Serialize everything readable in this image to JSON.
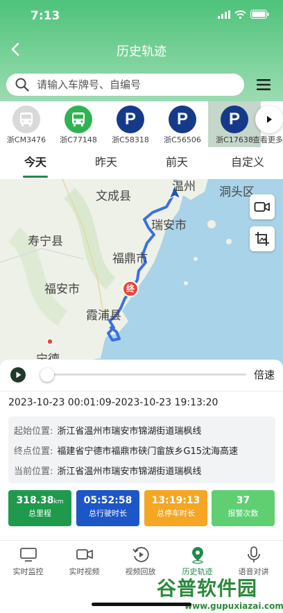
{
  "status_bar": {
    "time": "7:13"
  },
  "nav": {
    "title": "历史轨迹"
  },
  "search": {
    "placeholder": "请输入车牌号、自编号"
  },
  "vehicles": [
    {
      "plate": "浙CM3476",
      "icon": "bus-icon",
      "color": "#d9d9d9"
    },
    {
      "plate": "浙C77148",
      "icon": "bus-icon",
      "color": "#2fb352"
    },
    {
      "plate": "浙C58318",
      "icon": "parking-icon",
      "color": "#163a8a"
    },
    {
      "plate": "浙C56506",
      "icon": "parking-icon",
      "color": "#163a8a"
    },
    {
      "plate": "浙C17638",
      "icon": "parking-icon",
      "color": "#163a8a",
      "selected": true
    }
  ],
  "more_label": "查看更多",
  "tabs": [
    {
      "label": "今天",
      "active": true
    },
    {
      "label": "昨天"
    },
    {
      "label": "前天"
    },
    {
      "label": "自定义"
    }
  ],
  "map": {
    "labels": [
      "文成县",
      "温州",
      "洞头区",
      "瑞安市",
      "寿宁县",
      "福鼎市",
      "福安市",
      "霞浦县",
      "宁德"
    ],
    "end_marker": "终"
  },
  "playback": {
    "speed_label": "倍速",
    "progress": 0
  },
  "time_range": "2023-10-23 00:01:09-2023-10-23 19:13:20",
  "info": {
    "start_label": "起始位置:",
    "start_value": "浙江省温州市瑞安市锦湖街道瑞枫线",
    "end_label": "终点位置:",
    "end_value": "福建省宁德市福鼎市硖门畲族乡G15沈海高速",
    "current_label": "当前位置:",
    "current_value": "浙江省温州市瑞安市锦湖街道瑞枫线"
  },
  "stats": [
    {
      "value": "318.38",
      "unit": "km",
      "caption": "总里程",
      "color": "#1f9a4c"
    },
    {
      "value": "05:52:58",
      "unit": "",
      "caption": "总行驶时长",
      "color": "#1d56c7"
    },
    {
      "value": "13:19:13",
      "unit": "",
      "caption": "总停车时长",
      "color": "#f5a623"
    },
    {
      "value": "37",
      "unit": "",
      "caption": "报警次数",
      "color": "#5fcf71"
    }
  ],
  "bottom_nav": [
    {
      "label": "实时监控",
      "icon": "monitor-icon"
    },
    {
      "label": "实时视频",
      "icon": "video-camera-icon"
    },
    {
      "label": "视频回放",
      "icon": "replay-icon"
    },
    {
      "label": "历史轨迹",
      "icon": "location-pin-icon",
      "active": true
    },
    {
      "label": "语音对讲",
      "icon": "microphone-icon"
    }
  ],
  "watermark": {
    "main": "谷普软件园",
    "sub": "www.gupuxiazai.com"
  },
  "colors": {
    "accent": "#1e8a4c",
    "route": "#3d6fe0",
    "sea": "#a9d3e8",
    "land": "#eef1e8",
    "end_marker": "#e8453c"
  }
}
